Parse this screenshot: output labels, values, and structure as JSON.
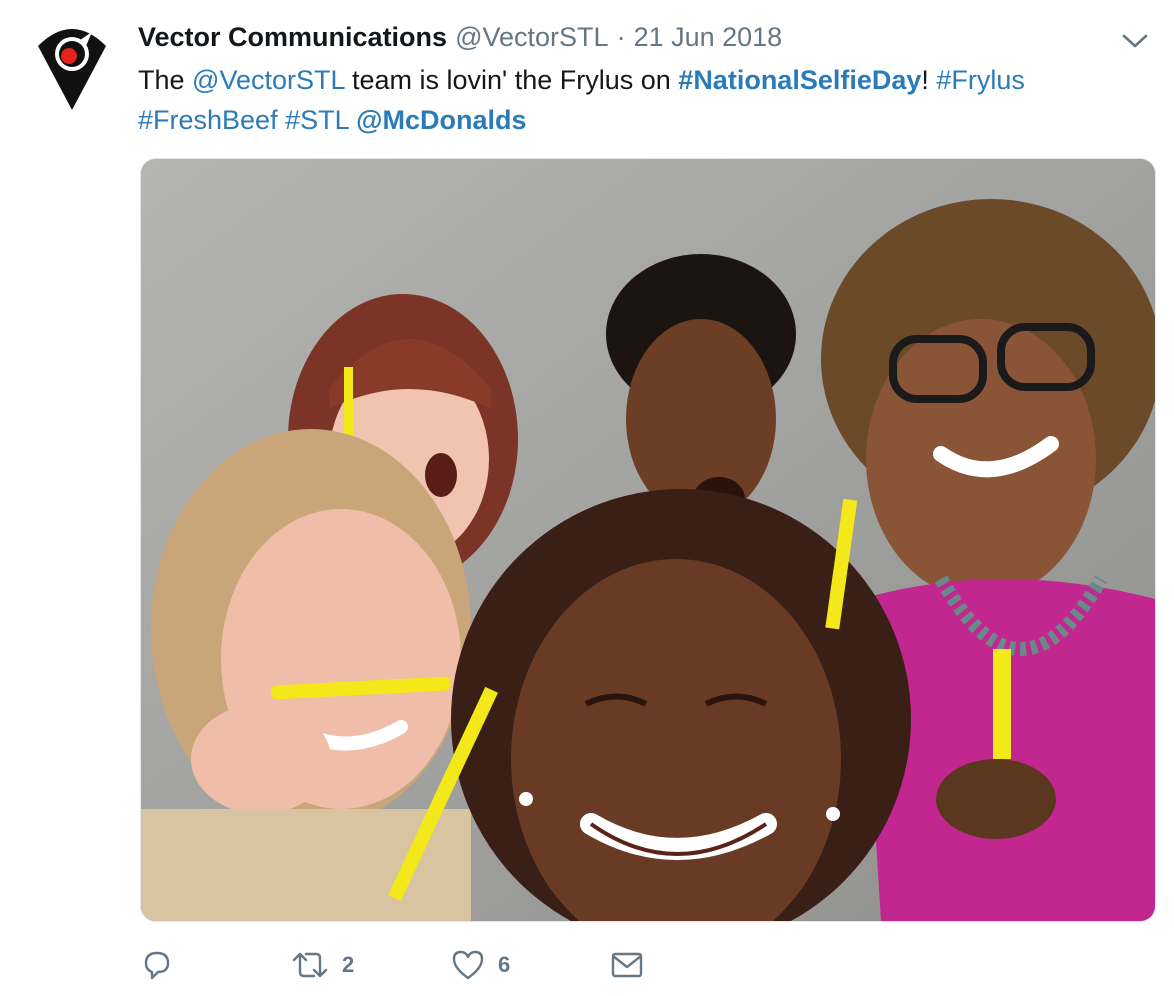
{
  "author": {
    "display_name": "Vector Communications",
    "handle": "@VectorSTL",
    "separator": "·",
    "date": "21 Jun 2018"
  },
  "tweet": {
    "segments": [
      {
        "text": "The ",
        "kind": "plain"
      },
      {
        "text": "@VectorSTL",
        "kind": "link"
      },
      {
        "text": " team is lovin' the Frylus on ",
        "kind": "plain"
      },
      {
        "text": "#NationalSelfieDay",
        "kind": "link-bold"
      },
      {
        "text": "! ",
        "kind": "plain"
      },
      {
        "text": "#Frylus",
        "kind": "link"
      },
      {
        "text": " ",
        "kind": "plain"
      },
      {
        "text": "#FreshBeef",
        "kind": "link"
      },
      {
        "text": " ",
        "kind": "plain"
      },
      {
        "text": "#STL",
        "kind": "link"
      },
      {
        "text": " ",
        "kind": "plain"
      },
      {
        "text": "@McDonalds",
        "kind": "link-bold"
      }
    ]
  },
  "actions": {
    "reply_count": "",
    "retweet_count": "2",
    "like_count": "6"
  },
  "icons": {
    "avatar": "vector-logo-icon",
    "caret": "chevron-down-icon",
    "reply": "reply-icon",
    "retweet": "retweet-icon",
    "like": "heart-icon",
    "dm": "envelope-icon"
  },
  "colors": {
    "link": "#2b7bb9",
    "muted": "#657786",
    "text": "#14171a",
    "avatar_red": "#e2231a"
  }
}
